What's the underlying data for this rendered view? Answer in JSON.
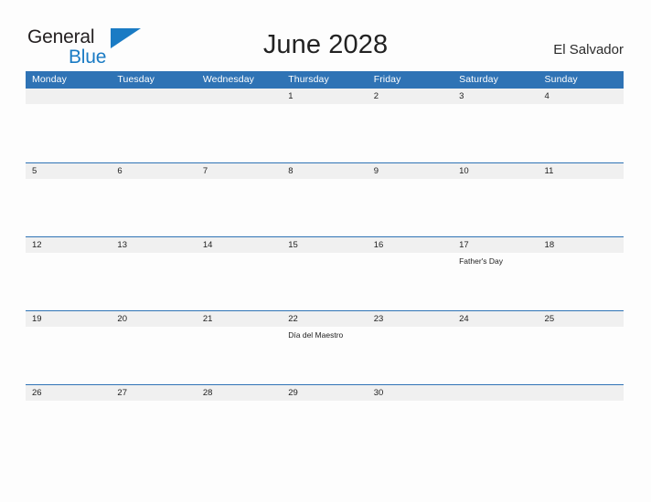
{
  "brand": {
    "name_part1": "General",
    "name_part2": "Blue",
    "flag_icon": "blue-triangle-flag-icon",
    "color_text": "#231f20",
    "color_blue": "#1a7bc4"
  },
  "header": {
    "title": "June 2028",
    "country": "El Salvador"
  },
  "theme": {
    "header_blue": "#2f73b5",
    "date_band_gray": "#f0f0f0",
    "page_background": "#fdfdfd",
    "text_color": "#222222"
  },
  "calendar": {
    "weekdays": [
      "Monday",
      "Tuesday",
      "Wednesday",
      "Thursday",
      "Friday",
      "Saturday",
      "Sunday"
    ],
    "weeks": [
      {
        "days": [
          {
            "date": "",
            "event": ""
          },
          {
            "date": "",
            "event": ""
          },
          {
            "date": "",
            "event": ""
          },
          {
            "date": "1",
            "event": ""
          },
          {
            "date": "2",
            "event": ""
          },
          {
            "date": "3",
            "event": ""
          },
          {
            "date": "4",
            "event": ""
          }
        ]
      },
      {
        "days": [
          {
            "date": "5",
            "event": ""
          },
          {
            "date": "6",
            "event": ""
          },
          {
            "date": "7",
            "event": ""
          },
          {
            "date": "8",
            "event": ""
          },
          {
            "date": "9",
            "event": ""
          },
          {
            "date": "10",
            "event": ""
          },
          {
            "date": "11",
            "event": ""
          }
        ]
      },
      {
        "days": [
          {
            "date": "12",
            "event": ""
          },
          {
            "date": "13",
            "event": ""
          },
          {
            "date": "14",
            "event": ""
          },
          {
            "date": "15",
            "event": ""
          },
          {
            "date": "16",
            "event": ""
          },
          {
            "date": "17",
            "event": "Father's Day"
          },
          {
            "date": "18",
            "event": ""
          }
        ]
      },
      {
        "days": [
          {
            "date": "19",
            "event": ""
          },
          {
            "date": "20",
            "event": ""
          },
          {
            "date": "21",
            "event": ""
          },
          {
            "date": "22",
            "event": "Día del Maestro"
          },
          {
            "date": "23",
            "event": ""
          },
          {
            "date": "24",
            "event": ""
          },
          {
            "date": "25",
            "event": ""
          }
        ]
      },
      {
        "days": [
          {
            "date": "26",
            "event": ""
          },
          {
            "date": "27",
            "event": ""
          },
          {
            "date": "28",
            "event": ""
          },
          {
            "date": "29",
            "event": ""
          },
          {
            "date": "30",
            "event": ""
          },
          {
            "date": "",
            "event": ""
          },
          {
            "date": "",
            "event": ""
          }
        ]
      }
    ]
  }
}
